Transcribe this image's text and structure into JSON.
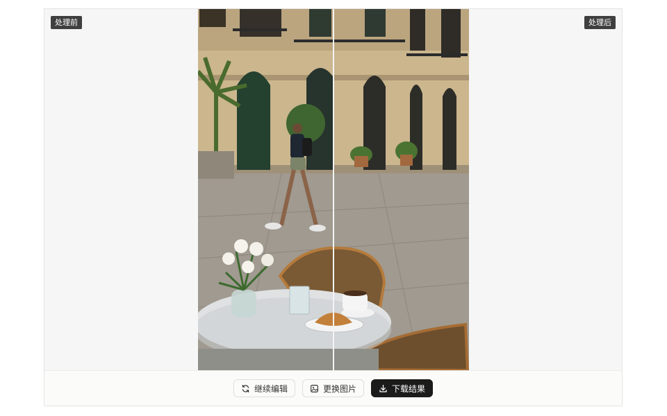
{
  "viewer": {
    "before_label": "处理前",
    "after_label": "处理后",
    "comparison_position": 0.5
  },
  "toolbar": {
    "continue_edit_label": "继续编辑",
    "replace_image_label": "更换图片",
    "download_label": "下载结果"
  },
  "icons": {
    "continue_edit": "refresh-icon",
    "replace_image": "image-edit-icon",
    "download": "download-icon"
  },
  "colors": {
    "primary_button": "#1b1b1b",
    "badge": "#3f3f3f"
  }
}
